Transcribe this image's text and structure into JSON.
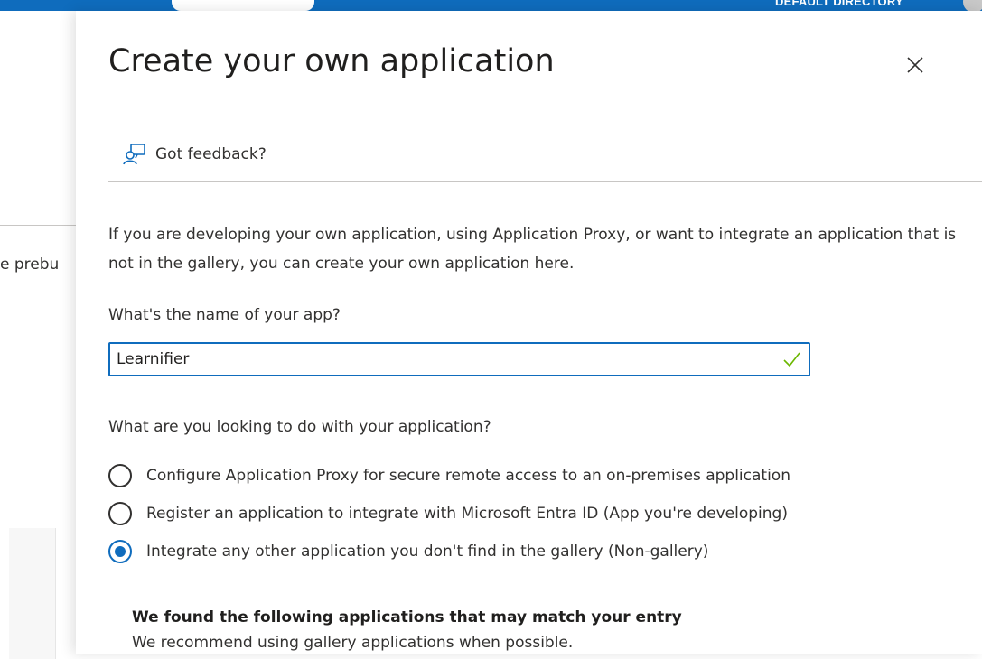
{
  "header": {
    "directory_label": "DEFAULT DIRECTORY"
  },
  "background": {
    "partial_text": "e prebu"
  },
  "panel": {
    "title": "Create your own application",
    "close_label": "×",
    "feedback_label": "Got feedback?",
    "intro_text": "If you are developing your own application, using Application Proxy, or want to integrate an application that is not in the gallery, you can create your own application here.",
    "name_field": {
      "label": "What's the name of your app?",
      "value": "Learnifier",
      "valid": true
    },
    "purpose_question": "What are you looking to do with your application?",
    "options": [
      {
        "label": "Configure Application Proxy for secure remote access to an on-premises application",
        "selected": false
      },
      {
        "label": "Register an application to integrate with Microsoft Entra ID (App you're developing)",
        "selected": false
      },
      {
        "label": "Integrate any other application you don't find in the gallery (Non-gallery)",
        "selected": true
      }
    ],
    "matches": {
      "title": "We found the following applications that may match your entry",
      "subtitle": "We recommend using gallery applications when possible."
    }
  },
  "colors": {
    "accent": "#0f6cbd",
    "valid": "#6bb700",
    "text": "#323130"
  }
}
